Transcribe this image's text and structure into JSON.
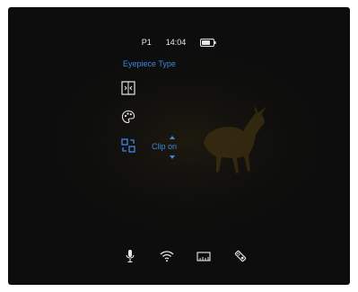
{
  "status_bar": {
    "profile": "P1",
    "time": "14:04",
    "battery_icon": "battery-icon"
  },
  "menu": {
    "title": "Eyepiece Type",
    "items": [
      {
        "icon": "eyepiece-frame-icon",
        "selected": false
      },
      {
        "icon": "palette-icon",
        "selected": false
      },
      {
        "icon": "eyepiece-swap-icon",
        "selected": true,
        "value": "Clip on"
      }
    ]
  },
  "bottom_bar": {
    "icons": [
      "microphone-icon",
      "wifi-icon",
      "ruler-icon",
      "ir-illuminator-icon"
    ]
  },
  "colors": {
    "accent": "#3f86e0",
    "background": "#0d0d0d",
    "text": "#e8e8e8",
    "scene": "#4a3a14"
  }
}
